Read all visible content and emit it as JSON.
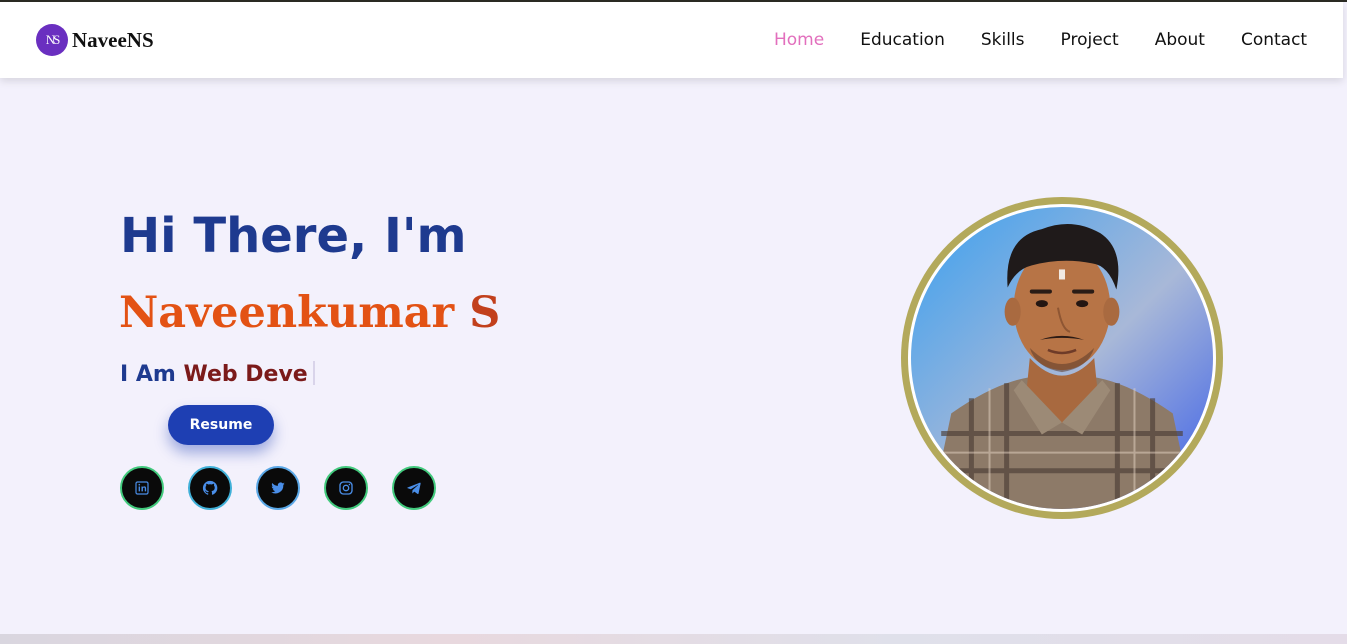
{
  "brand": {
    "logo_mark": "NS",
    "name": "NaveeNS",
    "accent": "#6a2fc0"
  },
  "nav": {
    "items": [
      {
        "label": "Home",
        "active": true
      },
      {
        "label": "Education",
        "active": false
      },
      {
        "label": "Skills",
        "active": false
      },
      {
        "label": "Project",
        "active": false
      },
      {
        "label": "About",
        "active": false
      },
      {
        "label": "Contact",
        "active": false
      }
    ],
    "active_color": "#e26fbd"
  },
  "hero": {
    "greeting": "Hi There, I'm",
    "first_name": "Naveenkumar",
    "last_name": "S",
    "typed_prefix": "I Am",
    "typed_role": "Web Deve",
    "resume_label": "Resume",
    "socials": [
      "linkedin-icon",
      "github-icon",
      "twitter-icon",
      "instagram-icon",
      "telegram-icon"
    ]
  },
  "colors": {
    "page_bg": "#f3f1fc",
    "heading": "#1e3a8f",
    "name": "#e35214",
    "role": "#7b1a1a",
    "button": "#1e3fb3",
    "photo_ring": "#b3a95b"
  }
}
